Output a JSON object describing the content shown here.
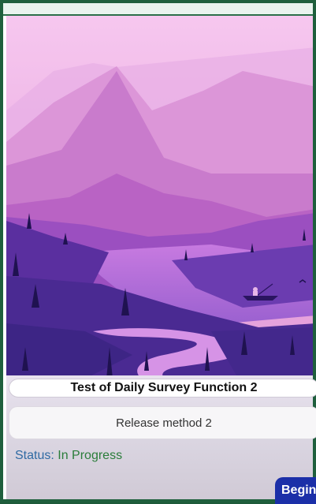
{
  "survey": {
    "title": "Test of Daily Survey Function 2",
    "release_method": "Release method 2",
    "status_label": "Status:",
    "status_value": "In Progress",
    "begin_label": "Begin"
  },
  "colors": {
    "frame_border": "#1f5f3d",
    "status_label": "#2f6aa3",
    "status_value": "#2a7d3a",
    "begin_button": "#1b2fa8"
  },
  "background_image": "purple-mountain-lake-illustration"
}
